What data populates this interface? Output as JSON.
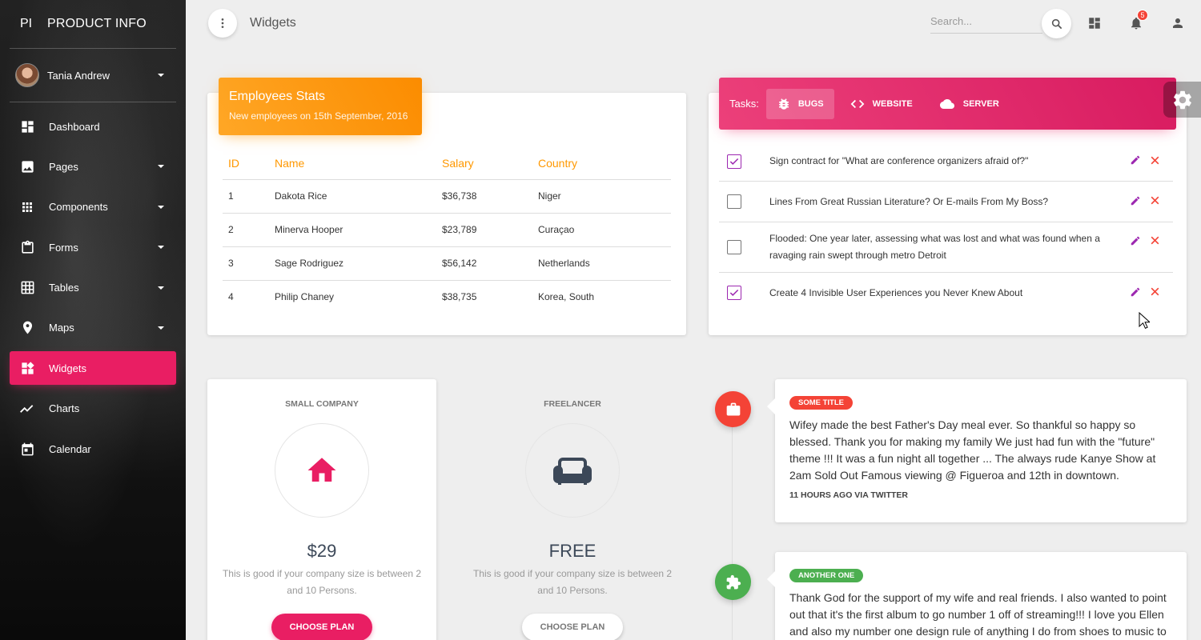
{
  "brand": {
    "mini": "PI",
    "full": "PRODUCT INFO"
  },
  "user": {
    "name": "Tania Andrew"
  },
  "sidebar": {
    "items": [
      {
        "label": "Dashboard",
        "icon": "dashboard-icon",
        "has_caret": false
      },
      {
        "label": "Pages",
        "icon": "image-icon",
        "has_caret": true
      },
      {
        "label": "Components",
        "icon": "apps-icon",
        "has_caret": true
      },
      {
        "label": "Forms",
        "icon": "clipboard-icon",
        "has_caret": true
      },
      {
        "label": "Tables",
        "icon": "grid-icon",
        "has_caret": true
      },
      {
        "label": "Maps",
        "icon": "place-icon",
        "has_caret": true
      },
      {
        "label": "Widgets",
        "icon": "widgets-icon",
        "has_caret": false,
        "active": true
      },
      {
        "label": "Charts",
        "icon": "timeline-icon",
        "has_caret": false
      },
      {
        "label": "Calendar",
        "icon": "calendar-icon",
        "has_caret": false
      }
    ]
  },
  "header": {
    "title": "Widgets",
    "search_placeholder": "Search...",
    "notifications_count": "5"
  },
  "employees": {
    "title": "Employees Stats",
    "subtitle": "New employees on 15th September, 2016",
    "columns": [
      "ID",
      "Name",
      "Salary",
      "Country"
    ],
    "rows": [
      [
        "1",
        "Dakota Rice",
        "$36,738",
        "Niger"
      ],
      [
        "2",
        "Minerva Hooper",
        "$23,789",
        "Curaçao"
      ],
      [
        "3",
        "Sage Rodriguez",
        "$56,142",
        "Netherlands"
      ],
      [
        "4",
        "Philip Chaney",
        "$38,735",
        "Korea, South"
      ]
    ]
  },
  "tasks": {
    "label": "Tasks:",
    "tabs": [
      {
        "label": "BUGS",
        "icon": "bug-icon",
        "active": true
      },
      {
        "label": "WEBSITE",
        "icon": "code-icon",
        "active": false
      },
      {
        "label": "SERVER",
        "icon": "cloud-icon",
        "active": false
      }
    ],
    "items": [
      {
        "text": "Sign contract for \"What are conference organizers afraid of?\"",
        "checked": true
      },
      {
        "text": "Lines From Great Russian Literature? Or E-mails From My Boss?",
        "checked": false
      },
      {
        "text": "Flooded: One year later, assessing what was lost and what was found when a ravaging rain swept through metro Detroit",
        "checked": false
      },
      {
        "text": "Create 4 Invisible User Experiences you Never Knew About",
        "checked": true
      }
    ]
  },
  "pricing": [
    {
      "category": "SMALL COMPANY",
      "icon": "home-icon",
      "price": "$29",
      "description": "This is good if your company size is between 2 and 10 Persons.",
      "button": "CHOOSE PLAN"
    },
    {
      "category": "FREELANCER",
      "icon": "sofa-icon",
      "price": "FREE",
      "description": "This is good if your company size is between 2 and 10 Persons.",
      "button": "CHOOSE PLAN"
    }
  ],
  "timeline": [
    {
      "badge": "SOME TITLE",
      "badge_color": "#f44336",
      "icon": "briefcase-icon",
      "body": "Wifey made the best Father's Day meal ever. So thankful so happy so blessed. Thank you for making my family We just had fun with the \"future\" theme !!! It was a fun night all together ... The always rude Kanye Show at 2am Sold Out Famous viewing @ Figueroa and 12th in downtown.",
      "footer": "11 HOURS AGO VIA TWITTER"
    },
    {
      "badge": "ANOTHER ONE",
      "badge_color": "#4caf50",
      "icon": "puzzle-icon",
      "body": "Thank God for the support of my wife and real friends. I also wanted to point out that it's the first album to go number 1 off of streaming!!! I love you Ellen and also my number one design rule of anything I do from shoes to music to"
    }
  ],
  "colors": {
    "primary": "#e91e63",
    "warning": "#ff9800",
    "danger": "#f44336",
    "success": "#4caf50"
  }
}
